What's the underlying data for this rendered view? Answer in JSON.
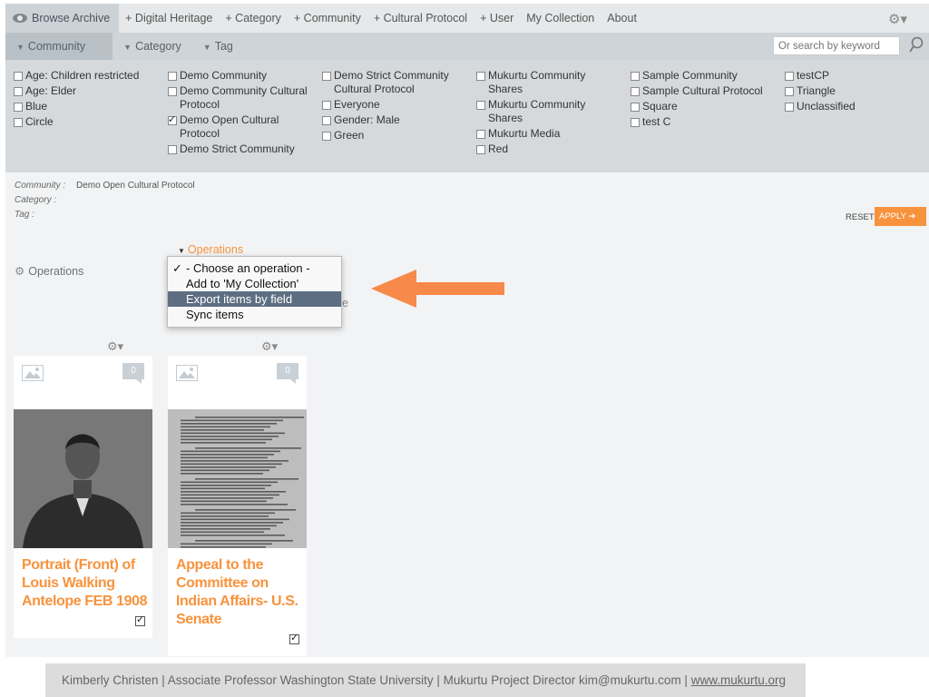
{
  "nav": {
    "items": [
      "Browse Archive",
      "+ Digital Heritage",
      "+ Category",
      "+ Community",
      "+ Cultural Protocol",
      "+ User",
      "My Collection",
      "About"
    ]
  },
  "filters": {
    "tabs": [
      "Community",
      "Category",
      "Tag"
    ],
    "search_placeholder": "Or search by keyword",
    "columns": [
      [
        {
          "label": "Age: Children restricted",
          "checked": false
        },
        {
          "label": "Age: Elder",
          "checked": false
        },
        {
          "label": "Blue",
          "checked": false
        },
        {
          "label": "Circle",
          "checked": false
        }
      ],
      [
        {
          "label": "Demo Community",
          "checked": false
        },
        {
          "label": "Demo Community Cultural Protocol",
          "checked": false
        },
        {
          "label": "Demo Open Cultural Protocol",
          "checked": true
        },
        {
          "label": "Demo Strict Community",
          "checked": false
        }
      ],
      [
        {
          "label": "Demo Strict Community Cultural Protocol",
          "checked": false
        },
        {
          "label": "Everyone",
          "checked": false
        },
        {
          "label": "Gender: Male",
          "checked": false
        },
        {
          "label": "Green",
          "checked": false
        }
      ],
      [
        {
          "label": "Mukurtu Community Shares",
          "checked": false
        },
        {
          "label": "Mukurtu Community Shares",
          "checked": false
        },
        {
          "label": "Mukurtu Media",
          "checked": false
        },
        {
          "label": "Red",
          "checked": false
        }
      ],
      [
        {
          "label": "Sample Community",
          "checked": false
        },
        {
          "label": "Sample Cultural Protocol",
          "checked": false
        },
        {
          "label": "Square",
          "checked": false
        },
        {
          "label": "test C",
          "checked": false
        }
      ],
      [
        {
          "label": "testCP",
          "checked": false
        },
        {
          "label": "Triangle",
          "checked": false
        },
        {
          "label": "Unclassified",
          "checked": false
        }
      ]
    ]
  },
  "summary": {
    "community_label": "Community :",
    "community_value": "Demo Open Cultural Protocol",
    "category_label": "Category :",
    "tag_label": "Tag :"
  },
  "actions": {
    "reset": "RESET",
    "apply": "APPLY"
  },
  "operations": {
    "label": "Operations",
    "trigger": "Operations",
    "options": [
      "- Choose an operation -",
      "Add to 'My Collection'",
      "Export items by field",
      "Sync items"
    ],
    "selected_index": 0,
    "highlighted_index": 2,
    "partial_text": "e"
  },
  "cards": [
    {
      "title": "Portrait (Front) of Louis Walking Antelope FEB 1908",
      "count": "0",
      "selected": true
    },
    {
      "title": "Appeal to the Committee on Indian Affairs- U.S. Senate",
      "count": "0",
      "selected": true
    }
  ],
  "footer": {
    "text": "Kimberly Christen | Associate Professor Washington State University | Mukurtu Project Director kim@mukurtu.com | ",
    "link": "www.mukurtu.org"
  },
  "colors": {
    "accent": "#f7933d",
    "highlight": "#5d6e82"
  }
}
